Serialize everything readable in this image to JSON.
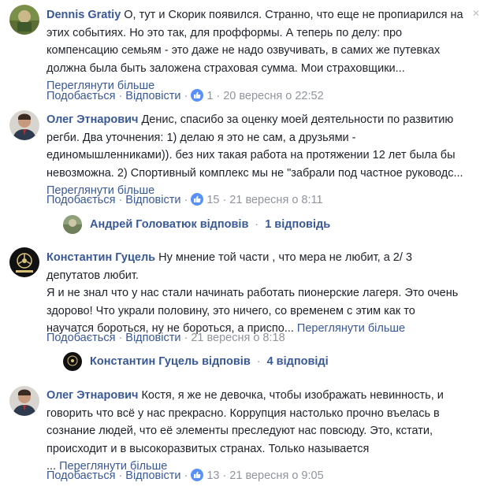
{
  "comments": [
    {
      "author": "Dennis Gratiy",
      "text": "О, тут и Скорик появился. Странно, что еще не пропиарился на этих событиях. Но это так, для профформы. А теперь по делу: про компенсацию семьям - это даже не надо озвучивать, в самих же путевках должна была быть заложена страховая сумма. Мои страховщики",
      "more": "Переглянути більше",
      "like_label": "Подобається",
      "reply_label": "Відповісти",
      "reactions": "1",
      "time": "20 вересня о 22:52"
    },
    {
      "author": "Олег Этнарович",
      "text": "Денис, спасибо за оценку моей деятельности по развитию регби. Два уточнения: 1) делаю я это не сам, а друзьями - единомышленниками)). без них такая работа на протяжении 12 лет была бы невозможна. 2) Спортивный комплекс мы не \"забрали под частное руководс",
      "more": "Переглянути більше",
      "like_label": "Подобається",
      "reply_label": "Відповісти",
      "reactions": "15",
      "time": "21 вересня о 8:11",
      "replies": {
        "author": "Андрей Головатюк",
        "verb": "відповів",
        "count": "1 відповідь"
      }
    },
    {
      "author": "Константин Гуцель",
      "text_lines": [
        "Ну мнение той части , что мера не любит, а 2/ 3 депутатов любит.",
        "Я и не знал что у нас стали начинать работать пионерские лагеря. Это очень здорово! Что украли половину, это ничего, со временем с этим как то научатся бороться, ну не бороться, а приспо"
      ],
      "more": "Переглянути більше",
      "like_label": "Подобається",
      "reply_label": "Відповісти",
      "time": "21 вересня о 8:18",
      "replies": {
        "author": "Константин Гуцель",
        "verb": "відповів",
        "count": "4 відповіді"
      }
    },
    {
      "author": "Олег Этнарович",
      "text": "Костя, я же не девочка, чтобы изображать невинность, и говорить что всё у нас прекрасно. Коррупция настолько прочно въелась в сознание людей, что её элементы преследуют нас повсюду. Это, кстати, происходит и в высокоразвитых странах. Только называется",
      "more": "Переглянути більше",
      "like_label": "Подобається",
      "reply_label": "Відповісти",
      "reactions": "13",
      "time": "21 вересня о 9:05"
    }
  ],
  "colors": {
    "link": "#385898",
    "meta": "#90949c",
    "like_badge": "#5890ff"
  },
  "icons": {
    "like": "thumbs-up-icon",
    "close": "close-icon"
  }
}
